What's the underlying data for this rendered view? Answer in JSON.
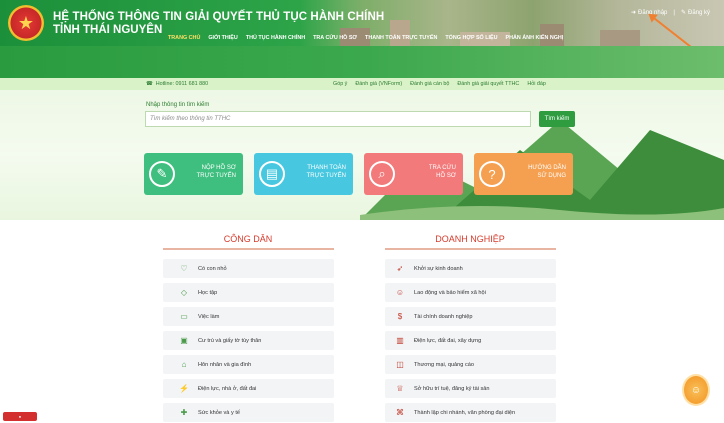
{
  "header": {
    "title_line1": "HỆ THỐNG THÔNG TIN GIẢI QUYẾT THỦ TỤC HÀNH CHÍNH",
    "title_line2": "TỈNH THÁI NGUYÊN",
    "login": "Đăng nhập",
    "register": "Đăng ký",
    "emblem_icon": "state-emblem-icon"
  },
  "nav": [
    "TRANG CHỦ",
    "GIỚI THIỆU",
    "THỦ TỤC HÀNH CHÍNH",
    "TRA CỨU HỒ SƠ",
    "THANH TOÁN TRỰC TUYẾN",
    "TỔNG HỢP SỐ LIỆU",
    "PHẢN ÁNH KIẾN NGHỊ"
  ],
  "infobar": {
    "hotline": "Hotline: 0911 681 880",
    "links": [
      "Góp ý",
      "Đánh giá (VNForm)",
      "Đánh giá cán bộ",
      "Đánh giá giải quyết TTHC",
      "Hỏi đáp"
    ]
  },
  "search": {
    "label": "Nhập thông tin tìm kiếm",
    "placeholder": "Tìm kiếm theo thông tin TTHC",
    "button": "Tìm kiếm"
  },
  "tiles": [
    {
      "line1": "NỘP HỒ SƠ",
      "line2": "TRỰC TUYẾN",
      "icon": "document-submit-icon"
    },
    {
      "line1": "THANH TOÁN",
      "line2": "TRỰC TUYẾN",
      "icon": "mobile-payment-icon"
    },
    {
      "line1": "TRA CỨU",
      "line2": "HỒ SƠ",
      "icon": "search-document-icon"
    },
    {
      "line1": "HƯỚNG DẪN",
      "line2": "SỬ DỤNG",
      "icon": "guide-icon"
    }
  ],
  "citizen": {
    "title": "CÔNG DÂN",
    "items": [
      "Có con nhỏ",
      "Học tập",
      "Việc làm",
      "Cư trú và giấy tờ tùy thân",
      "Hôn nhân và gia đình",
      "Điện lực, nhà ở, đất đai",
      "Sức khỏe và y tế"
    ]
  },
  "business": {
    "title": "DOANH NGHIỆP",
    "items": [
      "Khởi sự kinh doanh",
      "Lao động và bảo hiểm xã hội",
      "Tài chính doanh nghiệp",
      "Điện lực, đất đai, xây dựng",
      "Thương mại, quảng cáo",
      "Sở hữu trí tuệ, đăng ký tài sản",
      "Thành lập chi nhánh, văn phòng đại diện"
    ]
  },
  "colors": {
    "primary_green": "#2e9c3f",
    "title_red": "#d63a2b"
  }
}
